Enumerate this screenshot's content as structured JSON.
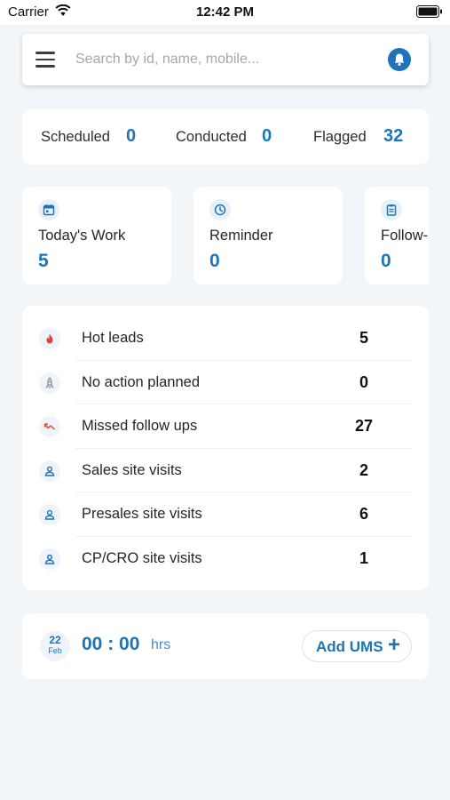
{
  "status_bar": {
    "carrier": "Carrier",
    "time": "12:42 PM"
  },
  "search": {
    "placeholder": "Search by id, name, mobile..."
  },
  "stats": [
    {
      "label": "Scheduled",
      "value": "0"
    },
    {
      "label": "Conducted",
      "value": "0"
    },
    {
      "label": "Flagged",
      "value": "32"
    }
  ],
  "work_cards": [
    {
      "label": "Today's Work",
      "value": "5",
      "icon": "calendar-icon"
    },
    {
      "label": "Reminder",
      "value": "0",
      "icon": "clock-icon"
    },
    {
      "label": "Follow-",
      "value": "0",
      "icon": "clipboard-icon"
    }
  ],
  "leads": [
    {
      "label": "Hot leads",
      "value": "5",
      "icon": "flame-icon",
      "icon_color": "#e0453a"
    },
    {
      "label": "No action planned",
      "value": "0",
      "icon": "rocket-icon",
      "icon_color": "#8a9096"
    },
    {
      "label": "Missed follow ups",
      "value": "27",
      "icon": "missed-call-icon",
      "icon_color": "#e0453a"
    },
    {
      "label": "Sales site visits",
      "value": "2",
      "icon": "person-icon",
      "icon_color": "#1d75b8"
    },
    {
      "label": "Presales site visits",
      "value": "6",
      "icon": "person-icon",
      "icon_color": "#1d75b8"
    },
    {
      "label": "CP/CRO site visits",
      "value": "1",
      "icon": "person-icon",
      "icon_color": "#1d75b8"
    }
  ],
  "ums": {
    "date_day": "22",
    "date_month": "Feb",
    "timer": "00 : 00",
    "timer_unit": "hrs",
    "add_label": "Add UMS",
    "add_icon": "+"
  },
  "colors": {
    "accent": "#1d75b8",
    "background": "#f3f6f8",
    "danger": "#e0453a"
  }
}
